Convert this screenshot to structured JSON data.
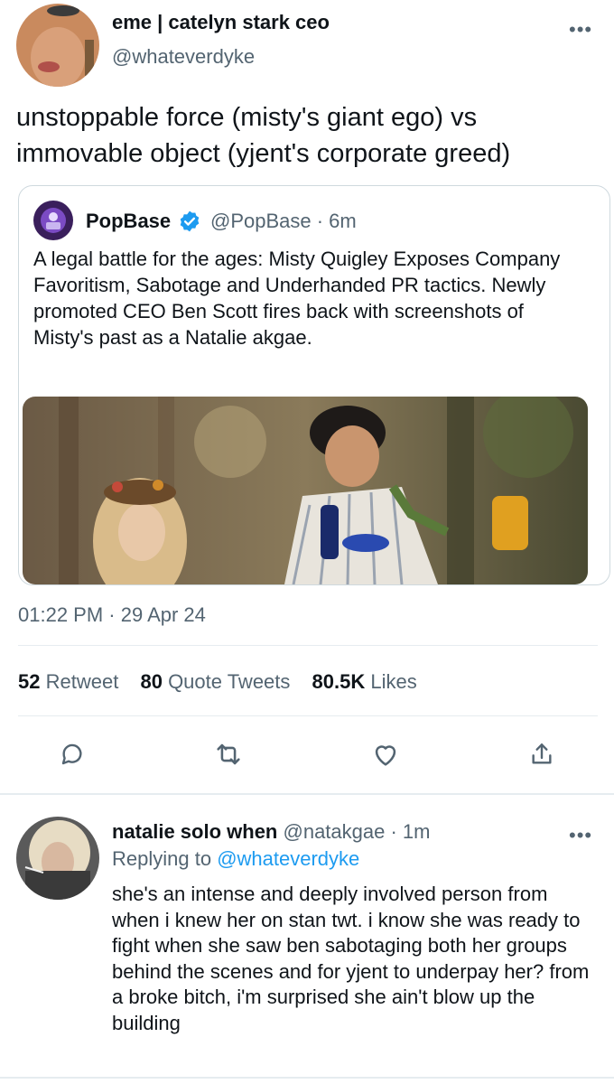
{
  "main_tweet": {
    "author_name": "eme | catelyn stark ceo",
    "author_handle": "@whateverdyke",
    "more_icon": "more-dots-icon",
    "text": "unstoppable force (misty's giant ego) vs immovable object (yjent's corporate greed)",
    "timestamp": "01:22 PM · 29 Apr 24",
    "stats": {
      "retweets_count": "52",
      "retweets_label": "Retweet",
      "quotes_count": "80",
      "quotes_label": "Quote Tweets",
      "likes_count": "80.5K",
      "likes_label": "Likes"
    },
    "actions": [
      "reply-icon",
      "retweet-icon",
      "like-icon",
      "share-icon"
    ]
  },
  "quoted_tweet": {
    "author_name": "PopBase",
    "verified_icon": "verified-badge-icon",
    "author_handle": "@PopBase · 6m",
    "text": "A legal battle for the ages: Misty Quigley Exposes Company Favoritism, Sabotage and Underhanded PR tactics. Newly promoted CEO Ben Scott fires back with screenshots of Misty's past as a Natalie akgae."
  },
  "reply_tweet": {
    "author_name": "natalie solo when",
    "author_handle": "@natakgae · 1m",
    "replying_to_prefix": "Replying to",
    "replying_to_handle": "@whateverdyke",
    "text": "she's an intense and deeply involved person from when i knew her on stan twt. i know she was ready to fight when she saw ben sabotaging both her groups behind the scenes and for yjent to underpay her? from a broke bitch,  i'm surprised she ain't blow up the building"
  },
  "colors": {
    "text_primary": "#0f1419",
    "text_secondary": "#536471",
    "link_blue": "#1d9bf0",
    "divider": "#e6ecf0",
    "card_border": "#cfd9de"
  }
}
